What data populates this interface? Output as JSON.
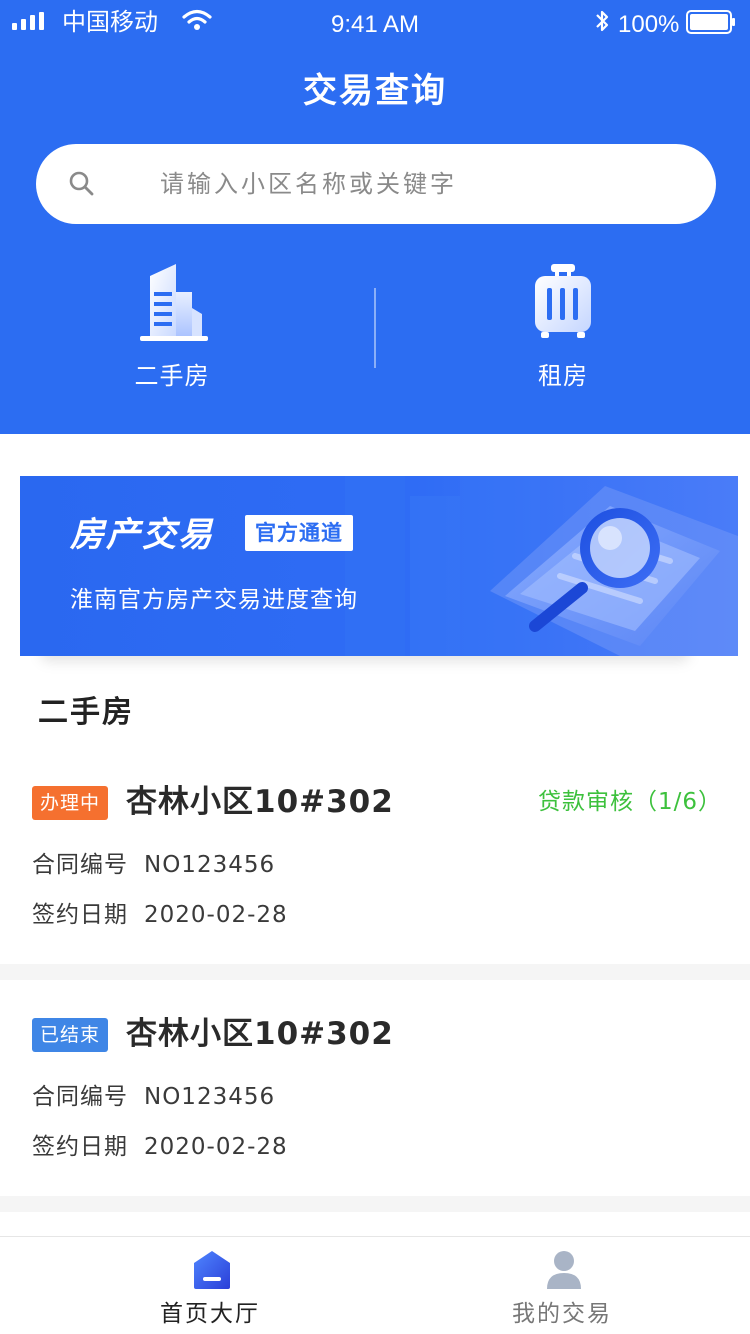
{
  "status_bar": {
    "carrier": "中国移动",
    "time": "9:41 AM",
    "battery": "100%"
  },
  "header": {
    "title": "交易查询",
    "search_placeholder": "请输入小区名称或关键字",
    "categories": [
      {
        "label": "二手房",
        "icon": "office-building-icon"
      },
      {
        "label": "租房",
        "icon": "luggage-icon"
      }
    ]
  },
  "banner": {
    "title": "房产交易",
    "badge": "官方通道",
    "subtitle": "淮南官方房产交易进度查询",
    "icon": "magnifier-illustration"
  },
  "section": {
    "title": "二手房"
  },
  "transactions": [
    {
      "tag": "办理中",
      "tag_color": "#f5702f",
      "title": "杏林小区10#302",
      "status": "贷款审核（1/6）",
      "status_color": "#3dc13d",
      "contract_label": "合同编号",
      "contract_no": "NO123456",
      "date_label": "签约日期",
      "date": "2020-02-28"
    },
    {
      "tag": "已结束",
      "tag_color": "#3f86e6",
      "title": "杏林小区10#302",
      "status": "",
      "contract_label": "合同编号",
      "contract_no": "NO123456",
      "date_label": "签约日期",
      "date": "2020-02-28"
    }
  ],
  "tabbar": {
    "items": [
      {
        "label": "首页大厅",
        "icon": "home-icon",
        "active": true
      },
      {
        "label": "我的交易",
        "icon": "user-icon",
        "active": false
      }
    ]
  },
  "colors": {
    "primary": "#2c6df2",
    "processing": "#f5702f",
    "finished": "#3f86e6",
    "status_green": "#3dc13d"
  }
}
